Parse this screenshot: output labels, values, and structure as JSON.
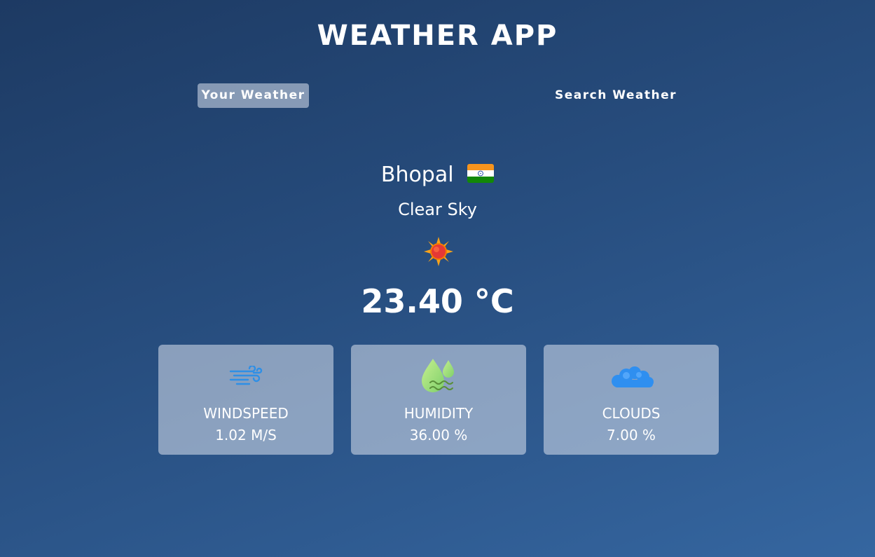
{
  "app": {
    "title": "WEATHER APP"
  },
  "tabs": [
    {
      "label": "Your Weather",
      "active": true
    },
    {
      "label": "Search Weather",
      "active": false
    }
  ],
  "weather": {
    "city": "Bhopal",
    "country_flag_icon": "india-flag-icon",
    "description": "Clear Sky",
    "condition_icon": "sun-icon",
    "temperature": "23.40 °C"
  },
  "stats": [
    {
      "icon": "wind-icon",
      "label": "WINDSPEED",
      "value": "1.02 M/S"
    },
    {
      "icon": "humidity-icon",
      "label": "HUMIDITY",
      "value": "36.00 %"
    },
    {
      "icon": "cloud-icon",
      "label": "CLOUDS",
      "value": "7.00 %"
    }
  ],
  "colors": {
    "background_top": "#1d3a63",
    "background_bottom": "#3566a0",
    "card_background": "#8fa3c2",
    "wind_icon": "#2e8fe6",
    "humidity_icon": "#a8e07c",
    "cloud_icon": "#2f8ff0"
  }
}
